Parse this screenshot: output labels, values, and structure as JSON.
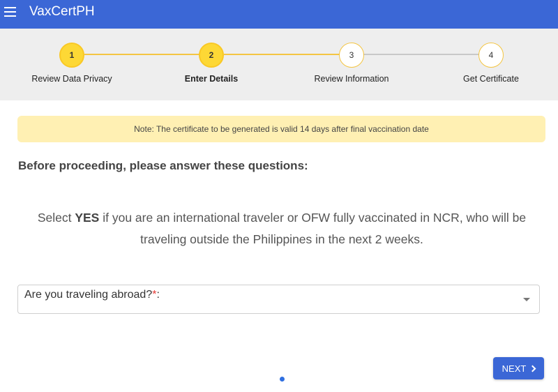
{
  "app": {
    "title": "VaxCertPH"
  },
  "steps": [
    {
      "number": "1",
      "label": "Review Data Privacy",
      "state": "done"
    },
    {
      "number": "2",
      "label": "Enter Details",
      "state": "current"
    },
    {
      "number": "3",
      "label": "Review Information",
      "state": "pending"
    },
    {
      "number": "4",
      "label": "Get Certificate",
      "state": "pending"
    }
  ],
  "note": "Note: The certificate to be generated is valid 14 days after final vaccination date",
  "heading": "Before proceeding, please answer these questions:",
  "instruction": {
    "prefix": "Select ",
    "emphasis": "YES",
    "suffix": " if you are an international traveler or OFW fully vaccinated in NCR, who will be traveling outside the Philippines in the next 2 weeks."
  },
  "question": {
    "label": "Are you traveling abroad?",
    "required_mark": "*",
    "colon": ":"
  },
  "next_button": {
    "label": "NEXT"
  },
  "colors": {
    "primary": "#3b67d6",
    "step_active": "#fdd835",
    "note_bg": "#fff0b3",
    "required": "#e53935"
  }
}
